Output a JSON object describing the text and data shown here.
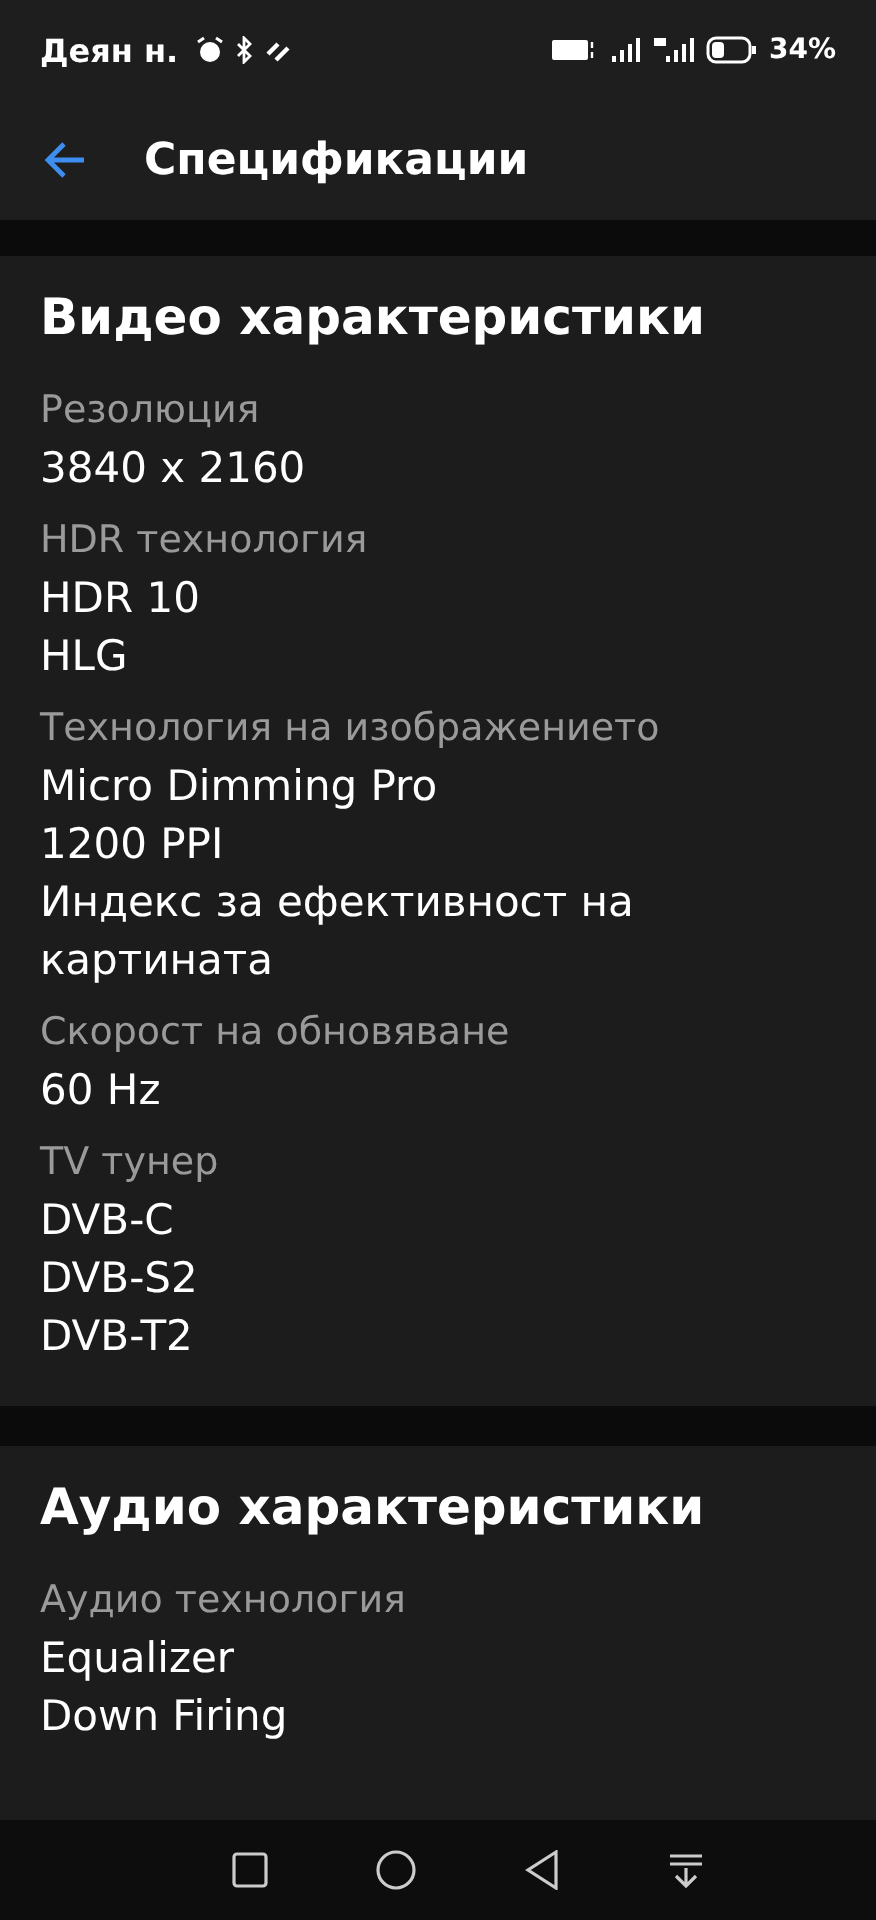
{
  "status_bar": {
    "time": "Деян н.",
    "battery": "34%"
  },
  "header": {
    "title": "Спецификации"
  },
  "sections": [
    {
      "title": "Видео характеристики",
      "specs": [
        {
          "label": "Резолюция",
          "values": [
            "3840 x 2160"
          ]
        },
        {
          "label": "HDR технология",
          "values": [
            "HDR 10",
            "HLG"
          ]
        },
        {
          "label": "Технология на изображението",
          "values": [
            "Micro Dimming Pro",
            "1200 PPI",
            "Индекс за ефективност на картината"
          ]
        },
        {
          "label": "Скорост на обновяване",
          "values": [
            "60 Hz"
          ]
        },
        {
          "label": "TV тунер",
          "values": [
            "DVB-C",
            "DVB-S2",
            "DVB-T2"
          ]
        }
      ]
    },
    {
      "title": "Аудио характеристики",
      "specs": [
        {
          "label": "Аудио технология",
          "values": [
            "Equalizer",
            "Down Firing"
          ]
        }
      ]
    }
  ]
}
